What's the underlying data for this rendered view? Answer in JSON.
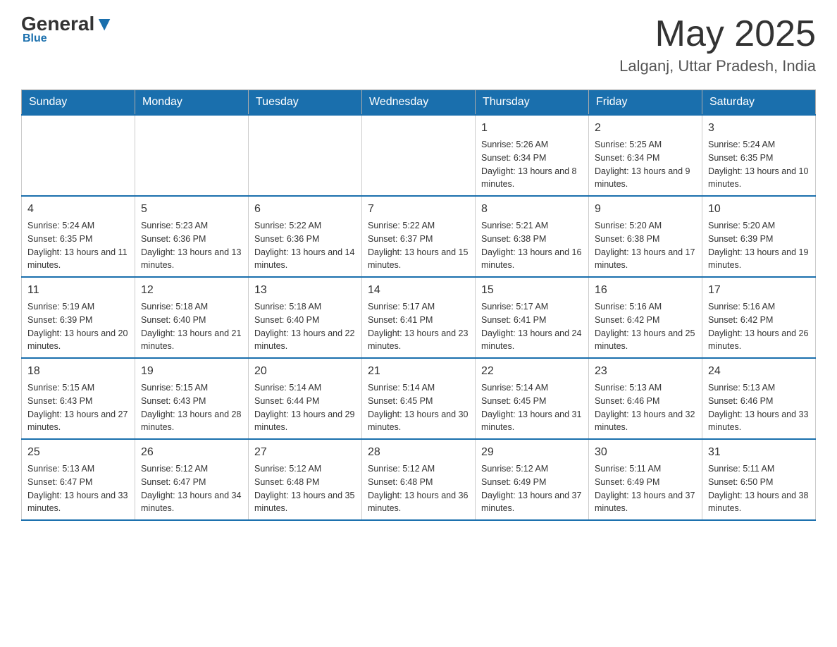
{
  "header": {
    "logo_general": "General",
    "logo_blue": "Blue",
    "month": "May 2025",
    "location": "Lalganj, Uttar Pradesh, India"
  },
  "days_of_week": [
    "Sunday",
    "Monday",
    "Tuesday",
    "Wednesday",
    "Thursday",
    "Friday",
    "Saturday"
  ],
  "weeks": [
    [
      {
        "day": "",
        "info": ""
      },
      {
        "day": "",
        "info": ""
      },
      {
        "day": "",
        "info": ""
      },
      {
        "day": "",
        "info": ""
      },
      {
        "day": "1",
        "info": "Sunrise: 5:26 AM\nSunset: 6:34 PM\nDaylight: 13 hours and 8 minutes."
      },
      {
        "day": "2",
        "info": "Sunrise: 5:25 AM\nSunset: 6:34 PM\nDaylight: 13 hours and 9 minutes."
      },
      {
        "day": "3",
        "info": "Sunrise: 5:24 AM\nSunset: 6:35 PM\nDaylight: 13 hours and 10 minutes."
      }
    ],
    [
      {
        "day": "4",
        "info": "Sunrise: 5:24 AM\nSunset: 6:35 PM\nDaylight: 13 hours and 11 minutes."
      },
      {
        "day": "5",
        "info": "Sunrise: 5:23 AM\nSunset: 6:36 PM\nDaylight: 13 hours and 13 minutes."
      },
      {
        "day": "6",
        "info": "Sunrise: 5:22 AM\nSunset: 6:36 PM\nDaylight: 13 hours and 14 minutes."
      },
      {
        "day": "7",
        "info": "Sunrise: 5:22 AM\nSunset: 6:37 PM\nDaylight: 13 hours and 15 minutes."
      },
      {
        "day": "8",
        "info": "Sunrise: 5:21 AM\nSunset: 6:38 PM\nDaylight: 13 hours and 16 minutes."
      },
      {
        "day": "9",
        "info": "Sunrise: 5:20 AM\nSunset: 6:38 PM\nDaylight: 13 hours and 17 minutes."
      },
      {
        "day": "10",
        "info": "Sunrise: 5:20 AM\nSunset: 6:39 PM\nDaylight: 13 hours and 19 minutes."
      }
    ],
    [
      {
        "day": "11",
        "info": "Sunrise: 5:19 AM\nSunset: 6:39 PM\nDaylight: 13 hours and 20 minutes."
      },
      {
        "day": "12",
        "info": "Sunrise: 5:18 AM\nSunset: 6:40 PM\nDaylight: 13 hours and 21 minutes."
      },
      {
        "day": "13",
        "info": "Sunrise: 5:18 AM\nSunset: 6:40 PM\nDaylight: 13 hours and 22 minutes."
      },
      {
        "day": "14",
        "info": "Sunrise: 5:17 AM\nSunset: 6:41 PM\nDaylight: 13 hours and 23 minutes."
      },
      {
        "day": "15",
        "info": "Sunrise: 5:17 AM\nSunset: 6:41 PM\nDaylight: 13 hours and 24 minutes."
      },
      {
        "day": "16",
        "info": "Sunrise: 5:16 AM\nSunset: 6:42 PM\nDaylight: 13 hours and 25 minutes."
      },
      {
        "day": "17",
        "info": "Sunrise: 5:16 AM\nSunset: 6:42 PM\nDaylight: 13 hours and 26 minutes."
      }
    ],
    [
      {
        "day": "18",
        "info": "Sunrise: 5:15 AM\nSunset: 6:43 PM\nDaylight: 13 hours and 27 minutes."
      },
      {
        "day": "19",
        "info": "Sunrise: 5:15 AM\nSunset: 6:43 PM\nDaylight: 13 hours and 28 minutes."
      },
      {
        "day": "20",
        "info": "Sunrise: 5:14 AM\nSunset: 6:44 PM\nDaylight: 13 hours and 29 minutes."
      },
      {
        "day": "21",
        "info": "Sunrise: 5:14 AM\nSunset: 6:45 PM\nDaylight: 13 hours and 30 minutes."
      },
      {
        "day": "22",
        "info": "Sunrise: 5:14 AM\nSunset: 6:45 PM\nDaylight: 13 hours and 31 minutes."
      },
      {
        "day": "23",
        "info": "Sunrise: 5:13 AM\nSunset: 6:46 PM\nDaylight: 13 hours and 32 minutes."
      },
      {
        "day": "24",
        "info": "Sunrise: 5:13 AM\nSunset: 6:46 PM\nDaylight: 13 hours and 33 minutes."
      }
    ],
    [
      {
        "day": "25",
        "info": "Sunrise: 5:13 AM\nSunset: 6:47 PM\nDaylight: 13 hours and 33 minutes."
      },
      {
        "day": "26",
        "info": "Sunrise: 5:12 AM\nSunset: 6:47 PM\nDaylight: 13 hours and 34 minutes."
      },
      {
        "day": "27",
        "info": "Sunrise: 5:12 AM\nSunset: 6:48 PM\nDaylight: 13 hours and 35 minutes."
      },
      {
        "day": "28",
        "info": "Sunrise: 5:12 AM\nSunset: 6:48 PM\nDaylight: 13 hours and 36 minutes."
      },
      {
        "day": "29",
        "info": "Sunrise: 5:12 AM\nSunset: 6:49 PM\nDaylight: 13 hours and 37 minutes."
      },
      {
        "day": "30",
        "info": "Sunrise: 5:11 AM\nSunset: 6:49 PM\nDaylight: 13 hours and 37 minutes."
      },
      {
        "day": "31",
        "info": "Sunrise: 5:11 AM\nSunset: 6:50 PM\nDaylight: 13 hours and 38 minutes."
      }
    ]
  ]
}
